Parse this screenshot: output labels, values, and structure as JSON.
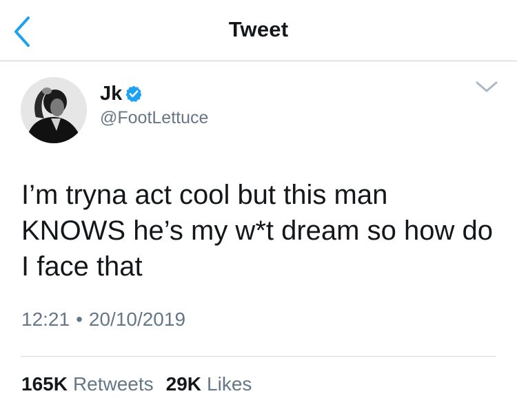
{
  "header": {
    "title": "Tweet",
    "back_icon": "chevron-left-icon",
    "accent_color": "#1da1f2"
  },
  "tweet": {
    "display_name": "Jk",
    "verified": true,
    "verified_icon": "verified-badge-icon",
    "handle": "@FootLettuce",
    "menu_icon": "chevron-down-icon",
    "text": "I’m tryna act cool but this man KNOWS he’s my w*t dream so how do I face that",
    "time": "12:21",
    "separator": "•",
    "date": "20/10/2019",
    "stats": {
      "retweets_count": "165K",
      "retweets_label": "Retweets",
      "likes_count": "29K",
      "likes_label": "Likes"
    }
  }
}
